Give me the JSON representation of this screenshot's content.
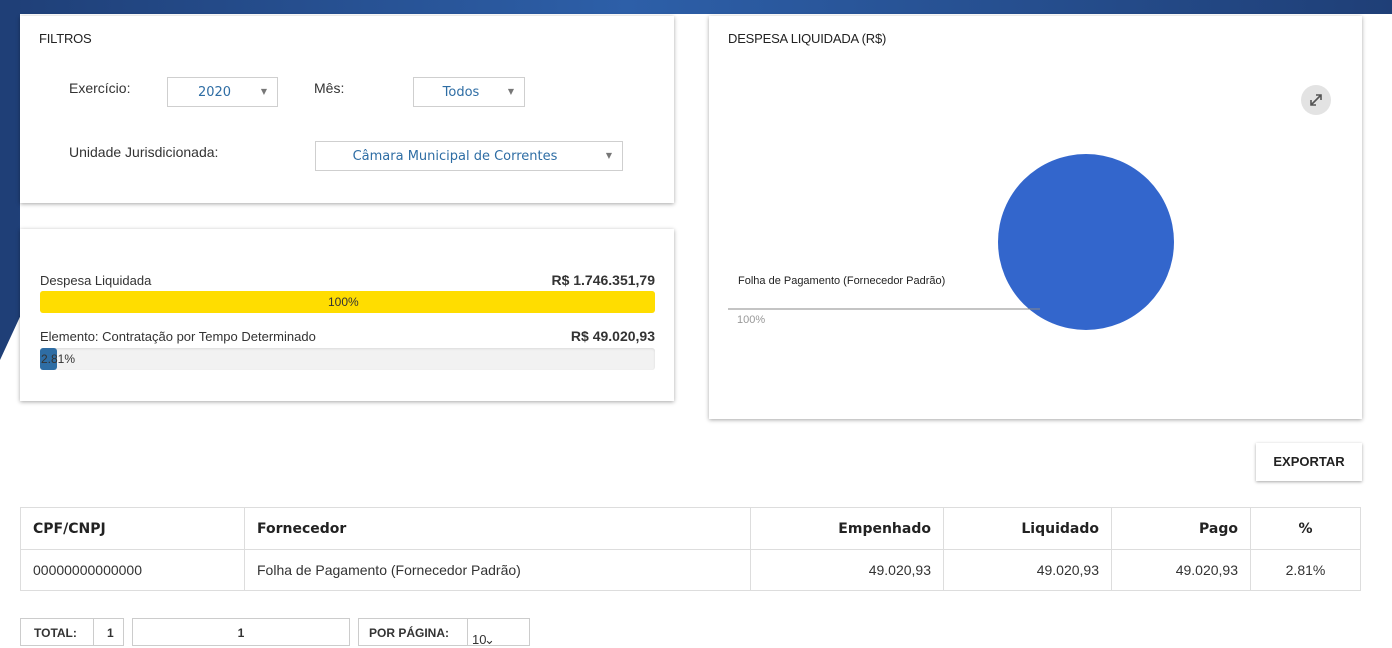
{
  "filters": {
    "title": "FILTROS",
    "exercicio_label": "Exercício:",
    "exercicio_value": "2020",
    "mes_label": "Mês:",
    "mes_value": "Todos",
    "unidade_label": "Unidade Jurisdicionada:",
    "unidade_value": "Câmara Municipal de Correntes"
  },
  "summary": {
    "despesa_label": "Despesa Liquidada",
    "despesa_value": "R$ 1.746.351,79",
    "despesa_percent_text": "100%",
    "despesa_fraction": 1.0,
    "elemento_label": "Elemento: Contratação por Tempo Determinado",
    "elemento_value": "R$ 49.020,93",
    "elemento_percent_text": "2.81%",
    "elemento_fraction": 0.0281,
    "colors": {
      "despesa_bar": "#ffdd00",
      "elemento_bar": "#2e6da4"
    }
  },
  "chart": {
    "title": "DESPESA LIQUIDADA (R$)",
    "expand_icon": "expand-arrows-icon"
  },
  "chart_data": {
    "type": "pie",
    "title": "DESPESA LIQUIDADA (R$)",
    "slices": [
      {
        "label": "Folha de Pagamento (Fornecedor Padrão)",
        "percent_text": "100%",
        "value": 100,
        "color": "#3366cc"
      }
    ]
  },
  "toolbar": {
    "export_label": "EXPORTAR"
  },
  "table": {
    "headers": [
      "CPF/CNPJ",
      "Fornecedor",
      "Empenhado",
      "Liquidado",
      "Pago",
      "%"
    ],
    "rows": [
      [
        "00000000000000",
        "Folha de Pagamento (Fornecedor Padrão)",
        "49.020,93",
        "49.020,93",
        "49.020,93",
        "2.81%"
      ]
    ]
  },
  "pager": {
    "total_label": "TOTAL:",
    "total_value": "1",
    "page_value": "1",
    "per_page_label": "POR PÁGINA:",
    "per_page_value": "10"
  }
}
